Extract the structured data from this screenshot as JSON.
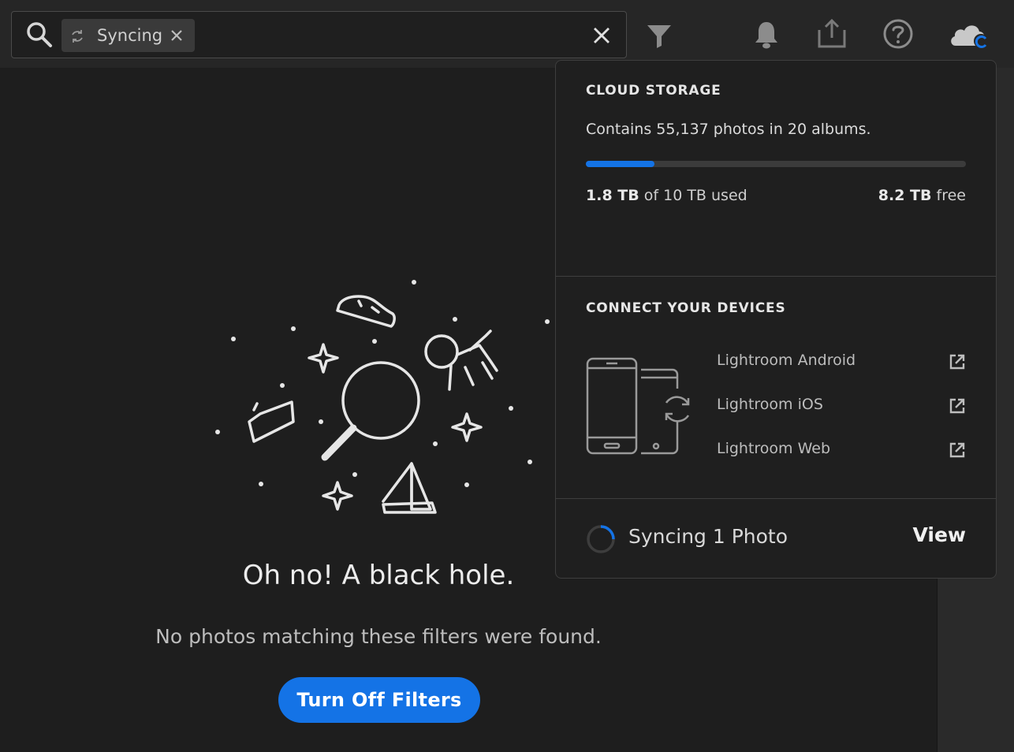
{
  "search": {
    "chip_label": "Syncing"
  },
  "empty_state": {
    "title": "Oh no! A black hole.",
    "subtitle": "No photos matching these filters were found.",
    "button_label": "Turn Off Filters"
  },
  "cloud_storage": {
    "heading": "CLOUD STORAGE",
    "contains_text": "Contains 55,137 photos in 20 albums.",
    "used_amount": "1.8 TB",
    "used_suffix": " of 10 TB used",
    "free_amount": "8.2 TB",
    "free_suffix": " free",
    "used_fraction": 0.18
  },
  "devices": {
    "heading": "CONNECT YOUR DEVICES",
    "links": [
      {
        "label": "Lightroom Android"
      },
      {
        "label": "Lightroom iOS"
      },
      {
        "label": "Lightroom Web"
      }
    ]
  },
  "sync": {
    "label": "Syncing 1 Photo",
    "view_label": "View"
  },
  "colors": {
    "accent": "#1473e6",
    "background": "#1e1e1e",
    "panel": "#1f1f1f"
  },
  "icons": [
    "search-icon",
    "sync-icon",
    "close-icon",
    "filter-icon",
    "bell-icon",
    "share-icon",
    "help-icon",
    "cloud-sync-icon",
    "external-link-icon",
    "spinner-icon"
  ]
}
